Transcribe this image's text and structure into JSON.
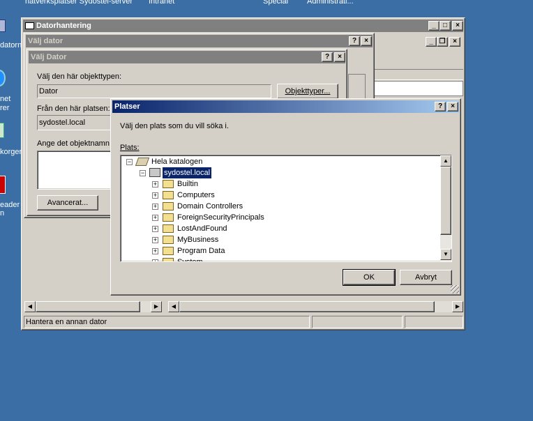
{
  "taskbar_top": {
    "items": [
      "nätverksplatser Sydostel-server",
      "Intranet",
      "Special",
      "Administrati..."
    ]
  },
  "desktop": {
    "icons": [
      {
        "label": "datorn"
      },
      {
        "label": "net"
      },
      {
        "label": "rer"
      },
      {
        "label": "korgen"
      },
      {
        "label": "eader"
      },
      {
        "label": "n"
      }
    ]
  },
  "main_window": {
    "title": "Datorhantering",
    "statusbar": "Hantera en annan dator"
  },
  "valj_dator_outer": {
    "title": "Välj dator"
  },
  "valj_dator_inner": {
    "title": "Välj Dator",
    "object_type_label": "Välj den här objekttypen:",
    "object_type_value": "Dator",
    "object_types_button": "Objekttyper...",
    "location_label": "Från den här platsen:",
    "location_value": "sydostel.local",
    "enter_name_label": "Ange det objektnamn",
    "advanced_button": "Avancerat..."
  },
  "platser": {
    "title": "Platser",
    "instruction": "Välj den plats som du vill söka i.",
    "location_label": "Plats:",
    "tree": {
      "root": "Hela katalogen",
      "domain": "sydostel.local",
      "children": [
        "Builtin",
        "Computers",
        "Domain Controllers",
        "ForeignSecurityPrincipals",
        "LostAndFound",
        "MyBusiness",
        "Program Data",
        "System"
      ]
    },
    "ok_button": "OK",
    "cancel_button": "Avbryt"
  }
}
